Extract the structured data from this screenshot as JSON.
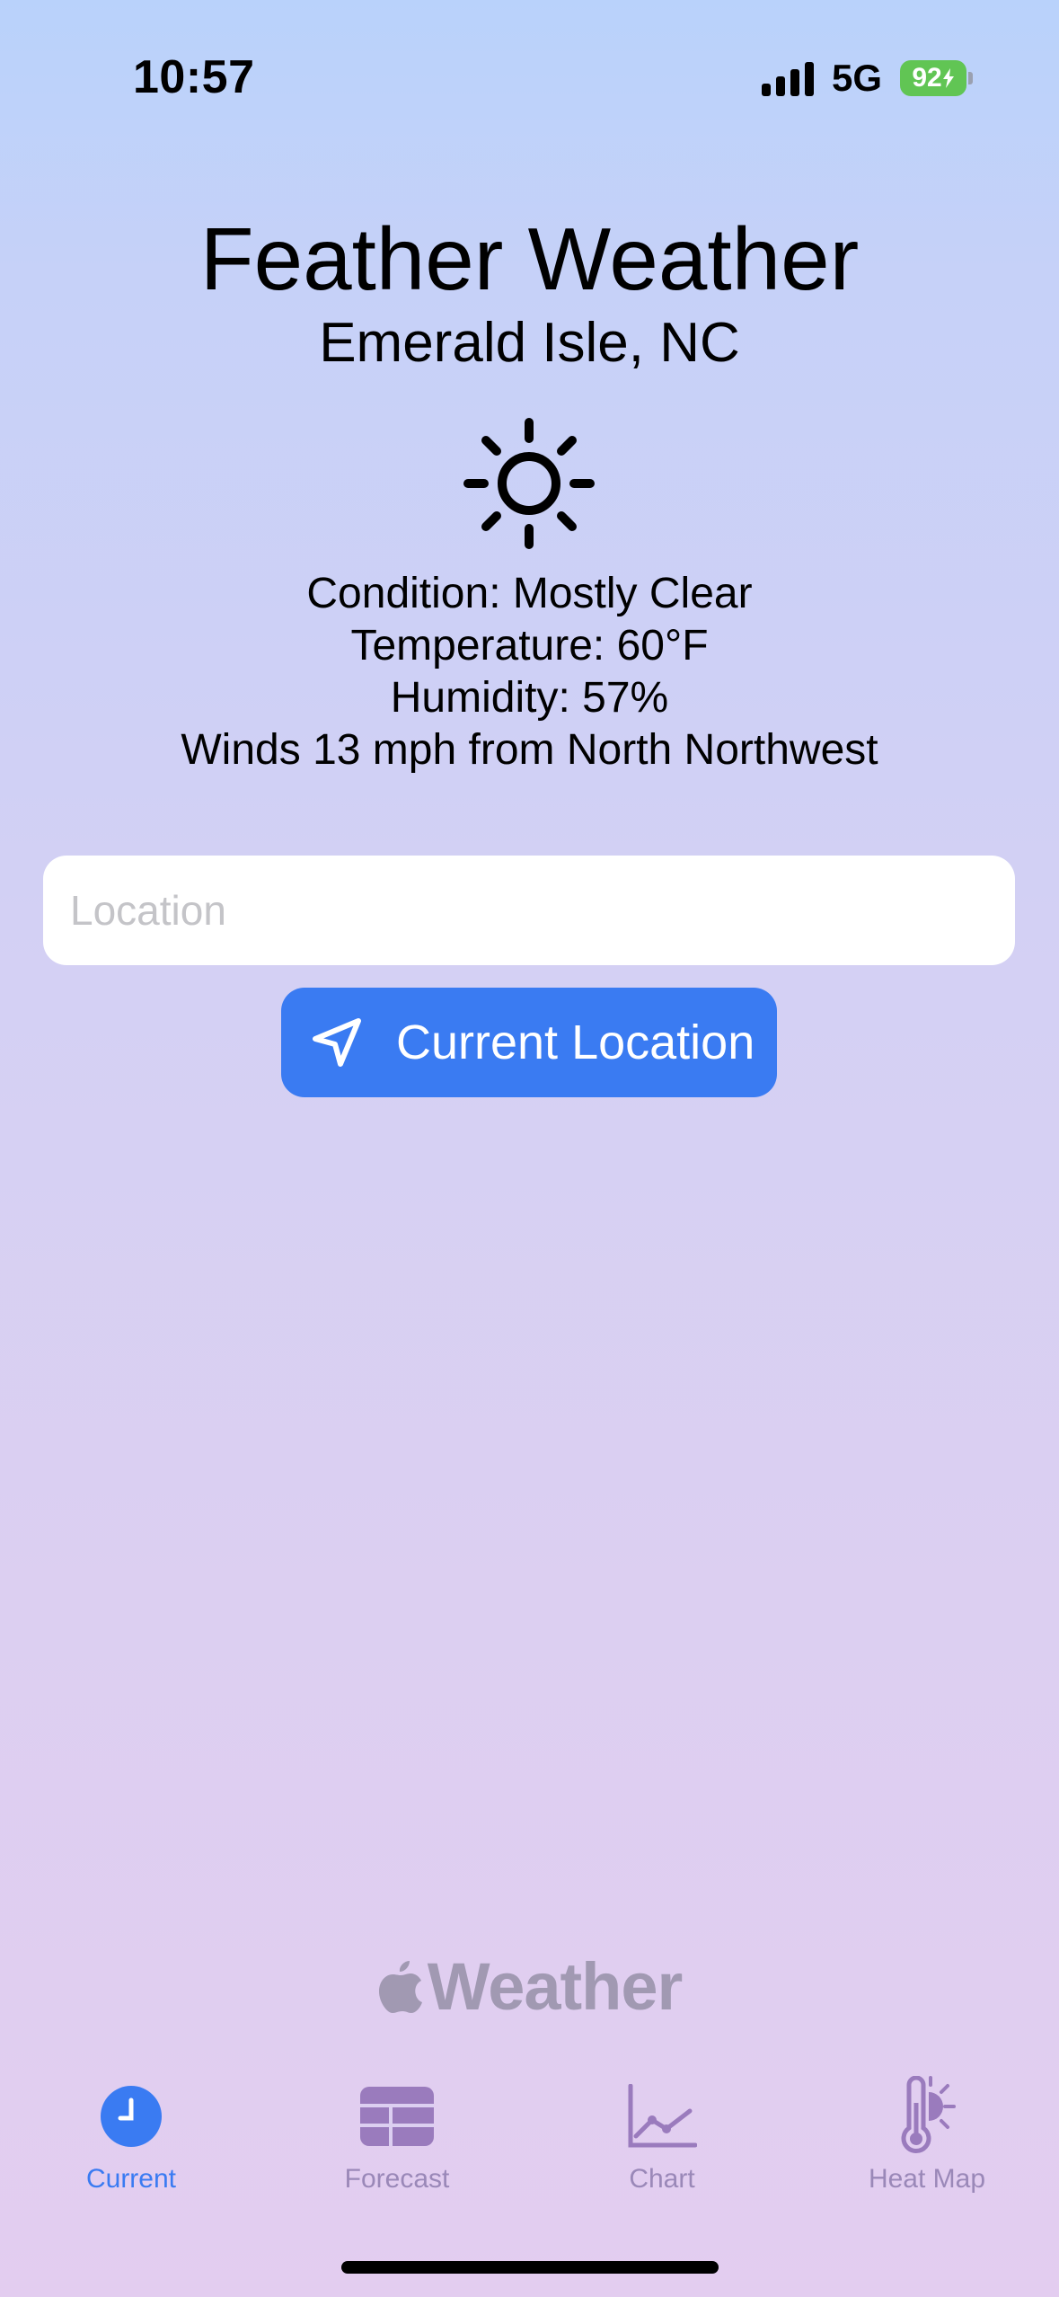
{
  "status_bar": {
    "time": "10:57",
    "network": "5G",
    "battery": "92"
  },
  "header": {
    "title": "Feather Weather",
    "location": "Emerald Isle, NC",
    "condition_icon": "sun-icon"
  },
  "weather": {
    "condition": "Condition: Mostly Clear",
    "temperature": "Temperature: 60°F",
    "humidity": "Humidity: 57%",
    "winds": "Winds 13 mph from North Northwest"
  },
  "search": {
    "placeholder": "Location",
    "value": ""
  },
  "location_button": {
    "label": "Current Location",
    "icon": "location-arrow-icon"
  },
  "attribution": {
    "text": "Weather",
    "icon": "apple-logo-icon"
  },
  "tabs": [
    {
      "label": "Current",
      "icon": "clock-icon",
      "active": true
    },
    {
      "label": "Forecast",
      "icon": "table-icon",
      "active": false
    },
    {
      "label": "Chart",
      "icon": "line-chart-icon",
      "active": false
    },
    {
      "label": "Heat Map",
      "icon": "thermometer-sun-icon",
      "active": false
    }
  ],
  "colors": {
    "accent": "#3a7bf2",
    "tab_inactive": "#9a88b8",
    "battery": "#61c554"
  }
}
